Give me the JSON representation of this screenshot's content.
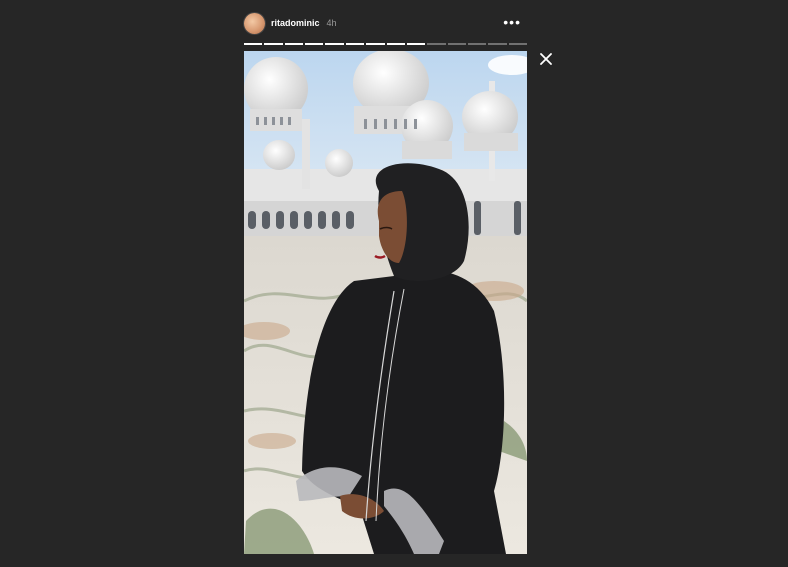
{
  "story": {
    "username": "ritadominic",
    "timestamp": "4h",
    "segments_total": 14,
    "segments_completed": 9
  },
  "icons": {
    "more": "more-horizontal-icon",
    "close": "close-icon"
  },
  "colors": {
    "background": "#262626",
    "progress_done": "#ffffff",
    "progress_todo": "rgba(255,255,255,0.35)"
  }
}
